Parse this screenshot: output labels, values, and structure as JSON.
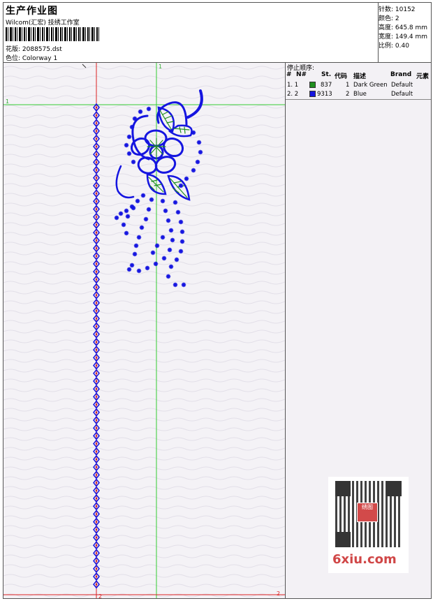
{
  "header": {
    "title": "生产作业图",
    "subtitle": "Wilcom(汇宏) 技绣工作室",
    "design_file": "花版: 2088575.dst",
    "colorway": "色位: Colorway 1"
  },
  "stats": {
    "stitches": "针数: 10152",
    "colors": "颜色: 2",
    "height": "高度: 645.8 mm",
    "width": "宽度: 149.4 mm",
    "scale": "比例: 0.40"
  },
  "canvas": {
    "marker_top_left": "1",
    "marker_top_center": "1",
    "marker_bottom_center": "2",
    "marker_bottom_right": "2"
  },
  "color_table": {
    "title": "停止顺序:",
    "columns": [
      "#",
      "N#",
      "St.",
      "代码",
      "描述",
      "Brand",
      "元素"
    ],
    "rows": [
      {
        "index": "1. 1",
        "color": "#1f8f1f",
        "stitches": "837",
        "code": "1",
        "description": "Dark Green",
        "brand": "Default"
      },
      {
        "index": "2. 2",
        "color": "#1515e0",
        "stitches": "9313",
        "code": "2",
        "description": "Blue",
        "brand": "Default"
      }
    ]
  },
  "watermark": {
    "seal_text": "绣图",
    "site_text": "6xiu.com"
  },
  "colors": {
    "guide_green": "#33cc33",
    "guide_red": "#dd2222",
    "thread_blue": "#1515e0",
    "thread_green": "#1f8f1f"
  }
}
